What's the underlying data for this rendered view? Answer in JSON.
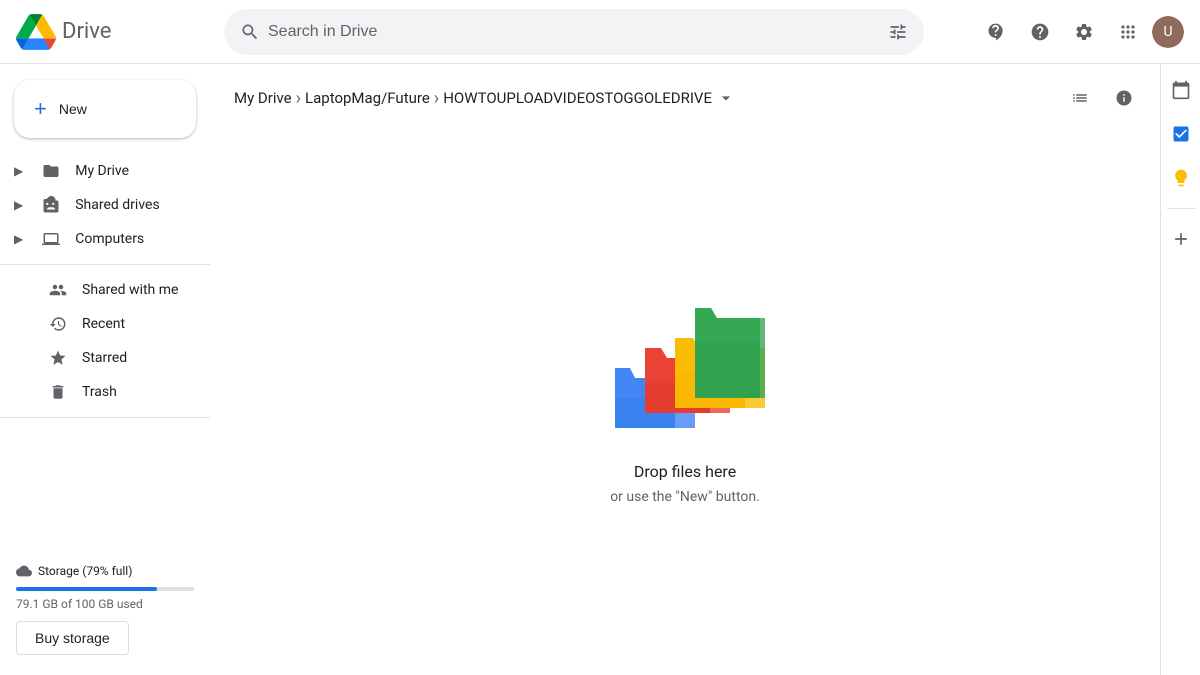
{
  "topbar": {
    "logo_text": "Drive",
    "search_placeholder": "Search in Drive"
  },
  "breadcrumb": {
    "items": [
      "My Drive",
      "LaptopMag/Future",
      "HOWTOUPLOADVIDEOSTOGGOLEDRIVE"
    ]
  },
  "sidebar": {
    "new_label": "New",
    "items": [
      {
        "id": "my-drive",
        "label": "My Drive",
        "icon": "folder"
      },
      {
        "id": "shared-drives",
        "label": "Shared drives",
        "icon": "shared-drive"
      },
      {
        "id": "computers",
        "label": "Computers",
        "icon": "computer"
      },
      {
        "id": "shared-with-me",
        "label": "Shared with me",
        "icon": "people"
      },
      {
        "id": "recent",
        "label": "Recent",
        "icon": "clock"
      },
      {
        "id": "starred",
        "label": "Starred",
        "icon": "star"
      },
      {
        "id": "trash",
        "label": "Trash",
        "icon": "trash"
      }
    ],
    "storage": {
      "label": "Storage (79% full)",
      "used_text": "79.1 GB of 100 GB used",
      "percent": 79,
      "buy_label": "Buy storage"
    }
  },
  "drop_zone": {
    "title": "Drop files here",
    "subtitle": "or use the \"New\" button."
  }
}
